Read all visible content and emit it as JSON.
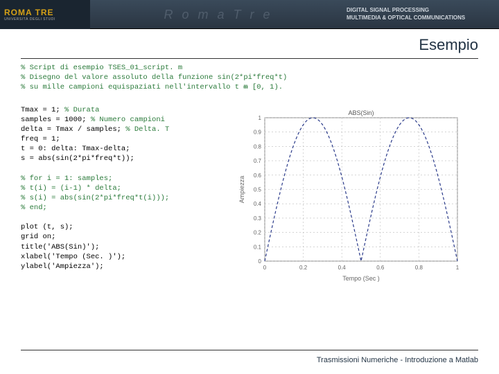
{
  "header": {
    "logo_main": "ROMA",
    "logo_sub1": "TRE",
    "logo_sub2": "UNIVERSITÀ DEGLI STUDI",
    "mid_text": "R o m a T r e",
    "right_line1": "DIGITAL SIGNAL PROCESSING",
    "right_line2": "MULTIMEDIA & OPTICAL COMMUNICATIONS"
  },
  "title": "Esempio",
  "code_top": [
    "% Script di esempio TSES_01_script. m",
    "% Disegno del valore assoluto della funzione sin(2*pi*freq*t)",
    "% su mille campioni equispaziati nell'intervallo t ᵯ [0, 1)."
  ],
  "code_block1": [
    {
      "t": "Tmax = 1; ",
      "c": "black"
    },
    {
      "t": "% Durata",
      "c": "green"
    },
    {
      "t": "\n",
      "c": "black"
    },
    {
      "t": "samples = 1000; ",
      "c": "black"
    },
    {
      "t": "% Numero campioni",
      "c": "green"
    },
    {
      "t": "\n",
      "c": "black"
    },
    {
      "t": "delta = Tmax / samples; ",
      "c": "black"
    },
    {
      "t": "% Delta. T",
      "c": "green"
    },
    {
      "t": "\n",
      "c": "black"
    },
    {
      "t": "freq = 1;\n",
      "c": "black"
    },
    {
      "t": "t = 0: delta: Tmax-delta;\n",
      "c": "black"
    },
    {
      "t": "s = abs(sin(2*pi*freq*t));",
      "c": "black"
    }
  ],
  "code_block2": [
    "% for i = 1: samples;",
    "% t(i) = (i-1) * delta;",
    "% s(i) = abs(sin(2*pi*freq*t(i)));",
    "% end;"
  ],
  "code_block3": [
    "plot (t, s);",
    "grid on;",
    "title('ABS(Sin)');",
    "xlabel('Tempo (Sec. )');",
    "ylabel('Ampiezza');"
  ],
  "footer": "Trasmissioni Numeriche - Introduzione a Matlab",
  "chart_data": {
    "type": "line",
    "title": "ABS(Sin)",
    "xlabel": "Tempo (Sec )",
    "ylabel": "Ampiezza",
    "xlim": [
      0,
      1
    ],
    "ylim": [
      0,
      1
    ],
    "xticks": [
      0,
      0.2,
      0.4,
      0.6,
      0.8,
      1
    ],
    "yticks": [
      0,
      0.1,
      0.2,
      0.3,
      0.4,
      0.5,
      0.6,
      0.7,
      0.8,
      0.9,
      1
    ],
    "series": [
      {
        "name": "abs(sin)",
        "formula": "abs(sin(2*pi*1*t))",
        "samples": 200
      }
    ]
  }
}
